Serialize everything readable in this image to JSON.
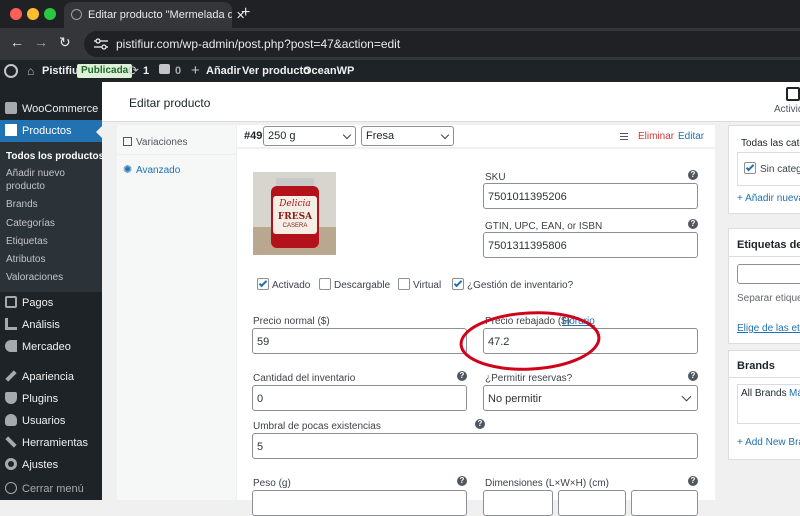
{
  "browser": {
    "tab_title": "Editar producto \"Mermelada d",
    "new_tab": "+",
    "url": "pistifiur.com/wp-admin/post.php?post=47&action=edit"
  },
  "adminbar": {
    "site_name": "Pistifiur",
    "status_badge": "Publicada",
    "updates_count": "1",
    "comments_count": "0",
    "new_label": "Añadir",
    "view_product": "Ver producto",
    "theme": "OceanWP"
  },
  "sidebar": {
    "woocommerce": "WooCommerce",
    "productos": "Productos",
    "subitems": [
      "Todos los productos",
      "Añadir nuevo",
      "producto",
      "Brands",
      "Categorías",
      "Etiquetas",
      "Atributos",
      "Valoraciones"
    ],
    "pagos": "Pagos",
    "analisis": "Análisis",
    "mercadeo": "Mercadeo",
    "apariencia": "Apariencia",
    "plugins": "Plugins",
    "usuarios": "Usuarios",
    "herramientas": "Herramientas",
    "ajustes": "Ajustes",
    "cerrar": "Cerrar menú"
  },
  "header": {
    "title": "Editar producto",
    "activity": "Activid"
  },
  "tabs": {
    "variaciones": "Variaciones",
    "avanzado": "Avanzado"
  },
  "variation": {
    "id": "#49",
    "attr1": "250 g",
    "attr2": "Fresa",
    "delete": "Eliminar",
    "edit": "Editar",
    "jar_brand": "Delicia",
    "jar_flavor": "FRESA",
    "jar_sub": "CASERA",
    "sku_label": "SKU",
    "sku_value": "7501011395206",
    "gtin_label": "GTIN, UPC, EAN, or ISBN",
    "gtin_value": "7501311395806",
    "checkboxes": [
      {
        "label": "Activado",
        "checked": true
      },
      {
        "label": "Descargable",
        "checked": false
      },
      {
        "label": "Virtual",
        "checked": false
      },
      {
        "label": "¿Gestión de inventario?",
        "checked": true
      }
    ],
    "regular_price_label": "Precio normal ($)",
    "regular_price": "59",
    "sale_price_label": "Precio rebajado ($)",
    "schedule_link": "Horario",
    "sale_price": "47.2",
    "stock_qty_label": "Cantidad del inventario",
    "stock_qty": "0",
    "backorders_label": "¿Permitir reservas?",
    "backorders_value": "No permitir",
    "low_stock_label": "Umbral de pocas existencias",
    "low_stock": "5",
    "weight_label": "Peso (g)",
    "dimensions_label": "Dimensiones (L×W×H) (cm)"
  },
  "right": {
    "cat_tab": "Todas las categ",
    "cat_item": "Sin categ",
    "add_cat": "+ Añadir nueva",
    "tags_title": "Etiquetas del p",
    "tags_sep": "Separar etiqueta",
    "tags_choose": "Elige de las etiq",
    "brands_title": "Brands",
    "brands_tab": "All Brands",
    "brands_tab2": "Má",
    "add_brand": "+ Add New Bran"
  },
  "colors": {
    "accent": "#2271b1",
    "admin_dark": "#1d2327",
    "active_menu": "#2271b1",
    "delete": "#d63638",
    "annotation": "#d0021b"
  }
}
